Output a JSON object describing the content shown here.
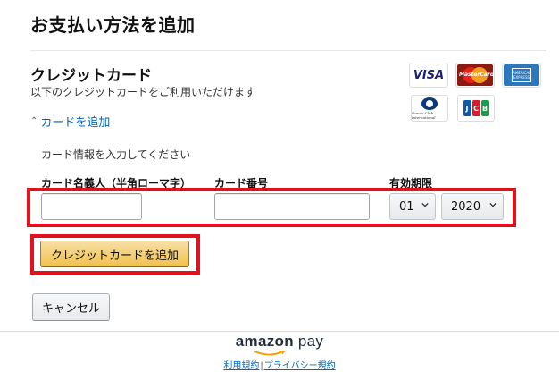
{
  "header": {
    "title": "お支払い方法を追加"
  },
  "credit_card": {
    "title": "クレジットカード",
    "subtitle": "以下のクレジットカードをご利用いただけます",
    "brands": {
      "visa": "VISA",
      "mastercard": "MasterCard",
      "amex": "AMERICAN EXPRESS",
      "diners": "Diners Club International",
      "jcb": "JCB"
    },
    "add_link": "カードを追加",
    "form_caption": "カード情報を入力してください",
    "labels": {
      "name": "カード名義人（半角ローマ字）",
      "number": "カード番号",
      "expiry": "有効期限"
    },
    "name_value": "",
    "number_value": "",
    "expiry_month": "01",
    "expiry_year": "2020",
    "add_button": "クレジットカードを追加",
    "cancel_button": "キャンセル"
  },
  "footer": {
    "brand_prefix": "amazon",
    "brand_suffix": "pay",
    "terms_link": "利用規約",
    "separator": "|",
    "privacy_link": "プライバシー規約"
  },
  "colors": {
    "highlight_red": "#e3111b",
    "link_blue": "#0066c0",
    "primary_button": "#f0c14b"
  }
}
